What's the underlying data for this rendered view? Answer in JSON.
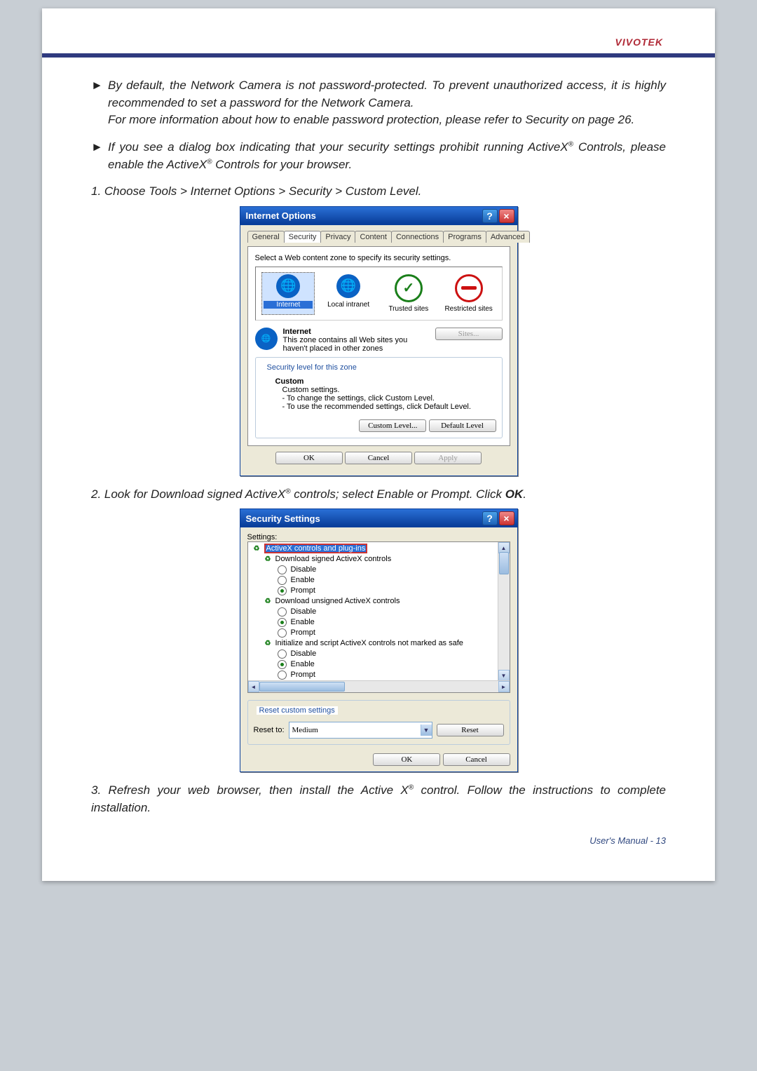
{
  "brand": "VIVOTEK",
  "footer": "User's Manual - 13",
  "para": {
    "p1": "By default, the Network Camera is not password-protected. To prevent unauthorized access, it is highly recommended to set a password for the Network Camera.",
    "p1b": "For more information about how to enable password protection, please refer to Security on page 26.",
    "p2a": "If you see a dialog box indicating that your security settings prohibit running ActiveX",
    "p2b": " Controls, please enable the ActiveX",
    "p2c": " Controls for your browser.",
    "step1": "1. Choose Tools > Internet Options > Security > Custom Level.",
    "step2a": "2. Look for Download signed ActiveX",
    "step2b": " controls; select Enable or Prompt. Click ",
    "step2ok": "OK",
    "step2dot": ".",
    "step3a": "3. Refresh your web browser, then install the Active X",
    "step3b": " control. Follow the instructions to complete installation.",
    "reg": "®"
  },
  "io": {
    "title": "Internet Options",
    "tabs": [
      "General",
      "Security",
      "Privacy",
      "Content",
      "Connections",
      "Programs",
      "Advanced"
    ],
    "instruct": "Select a Web content zone to specify its security settings.",
    "zones": {
      "internet": "Internet",
      "local": "Local intranet",
      "trusted": "Trusted sites",
      "restricted": "Restricted sites"
    },
    "zoneHead": "Internet",
    "zoneDesc": "This zone contains all Web sites you haven't placed in other zones",
    "sitesBtn": "Sites...",
    "secLevelLegend": "Security level for this zone",
    "custom": "Custom",
    "customSettings": "Custom settings.",
    "customL1": "- To change the settings, click Custom Level.",
    "customL2": "- To use the recommended settings, click Default Level.",
    "btnCustom": "Custom Level...",
    "btnDefault": "Default Level",
    "ok": "OK",
    "cancel": "Cancel",
    "apply": "Apply"
  },
  "ss": {
    "title": "Security Settings",
    "settings": "Settings:",
    "nodes": {
      "root": "ActiveX controls and plug-ins",
      "n1": "Download signed ActiveX controls",
      "n2": "Download unsigned ActiveX controls",
      "n3": "Initialize and script ActiveX controls not marked as safe",
      "disable": "Disable",
      "enable": "Enable",
      "prompt": "Prompt"
    },
    "resetLegend": "Reset custom settings",
    "resetTo": "Reset to:",
    "resetVal": "Medium",
    "resetBtn": "Reset",
    "ok": "OK",
    "cancel": "Cancel"
  }
}
